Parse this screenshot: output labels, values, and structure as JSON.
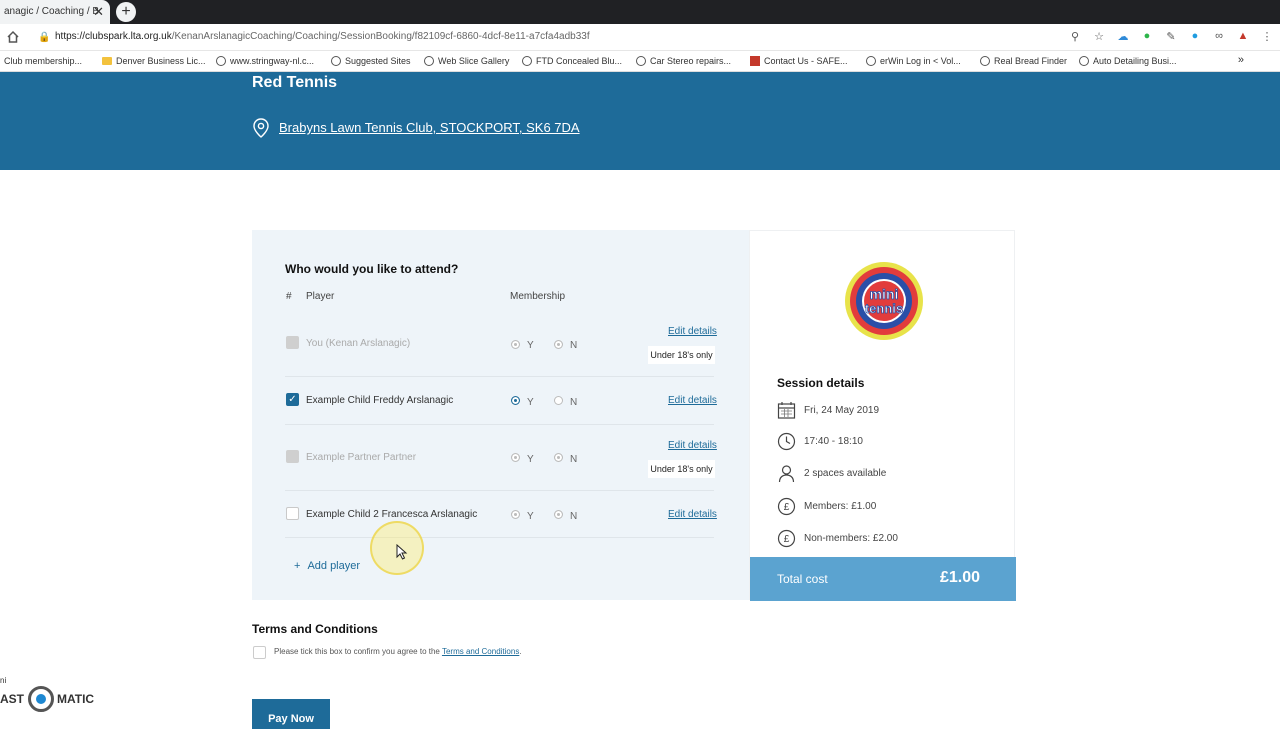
{
  "browser": {
    "tab_title": "anagic / Coaching / B",
    "tab_close": "✕",
    "new_tab": "+",
    "url_host": "https://clubspark.lta.org.uk",
    "url_path": "/KenanArslanagicCoaching/Coaching/SessionBooking/f82109cf-6860-4dcf-8e11-a7cfa4adb33f",
    "bookmarks": [
      {
        "label": "Club membership...",
        "icon": "none"
      },
      {
        "label": "Denver Business Lic...",
        "icon": "folder-icon"
      },
      {
        "label": "www.stringway-nl.c...",
        "icon": "globe-icon"
      },
      {
        "label": "Suggested Sites",
        "icon": "globe-icon"
      },
      {
        "label": "Web Slice Gallery",
        "icon": "globe-icon"
      },
      {
        "label": "FTD Concealed Blu...",
        "icon": "globe-icon"
      },
      {
        "label": "Car Stereo repairs...",
        "icon": "globe-icon"
      },
      {
        "label": "Contact Us - SAFE...",
        "icon": "square-icon"
      },
      {
        "label": "erWin Log in < Vol...",
        "icon": "globe-icon"
      },
      {
        "label": "Real Bread Finder",
        "icon": "globe-icon"
      },
      {
        "label": "Auto Detailing Busi...",
        "icon": "globe-icon"
      }
    ],
    "bookmarks_more": "»"
  },
  "hero": {
    "title": "Red Tennis",
    "location": "Brabyns Lawn Tennis Club, STOCKPORT, SK6 7DA"
  },
  "attend": {
    "title": "Who would you like to attend?",
    "col_hash": "#",
    "col_player": "Player",
    "col_membership": "Membership",
    "yes": "Y",
    "no": "N",
    "edit": "Edit details",
    "under18": "Under 18's only",
    "players": [
      {
        "name": "You (Kenan Arslanagic)",
        "state": "disabled",
        "membership": "none",
        "under18": true
      },
      {
        "name": "Example Child Freddy Arslanagic",
        "state": "checked",
        "membership": "Y",
        "under18": false
      },
      {
        "name": "Example Partner Partner",
        "state": "disabled",
        "membership": "none",
        "under18": true
      },
      {
        "name": "Example Child 2 Francesca Arslanagic",
        "state": "unchecked",
        "membership": "none",
        "under18": false
      }
    ],
    "add_player": "Add player",
    "add_plus": "+"
  },
  "session": {
    "title": "Session details",
    "date": "Fri, 24 May 2019",
    "time": "17:40 - 18:10",
    "spaces": "2 spaces available",
    "members": "Members: £1.00",
    "non_members": "Non-members: £2.00",
    "total_label": "Total cost",
    "total_value": "£1.00",
    "logo_line1": "mini",
    "logo_line2": "tennis"
  },
  "terms": {
    "title": "Terms and Conditions",
    "text": "Please tick this box to confirm you agree to the",
    "link": "Terms and Conditions",
    "end": "."
  },
  "pay_now": "Pay Now",
  "watermark": {
    "small": "ni",
    "left": "AST",
    "right": "MATIC"
  },
  "colors": {
    "brand": "#1e6b99",
    "total_bar": "#5ba3d0",
    "panel_bg": "#eef4f9"
  }
}
